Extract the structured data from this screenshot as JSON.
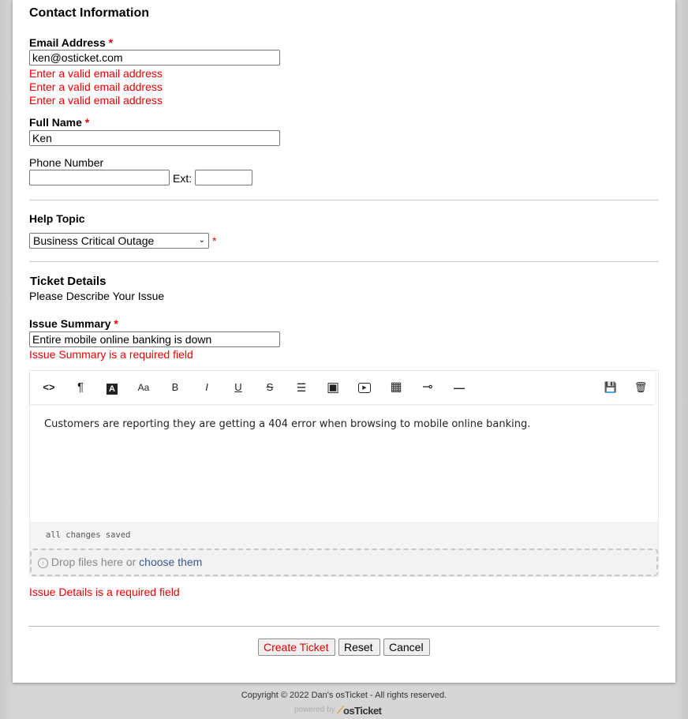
{
  "contact": {
    "heading": "Contact Information",
    "email_label": "Email Address",
    "required_mark": "*",
    "email_value": "ken@osticket.com",
    "email_errors": [
      "Enter a valid email address",
      "Enter a valid email address",
      "Enter a valid email address"
    ],
    "name_label": "Full Name",
    "name_value": "Ken",
    "phone_label": "Phone Number",
    "phone_value": "",
    "ext_label": "Ext:",
    "ext_value": ""
  },
  "help_topic": {
    "label": "Help Topic",
    "selected": "Business Critical Outage"
  },
  "ticket": {
    "heading": "Ticket Details",
    "subheading": "Please Describe Your Issue",
    "summary_label": "Issue Summary",
    "summary_value": "Entire mobile online banking is down",
    "summary_error": "Issue Summary is a required field",
    "editor_content": "Customers are reporting they are getting a 404 error when browsing to mobile online banking.",
    "saved_status": "all changes saved",
    "drop_text": "Drop files here or",
    "drop_link": "choose them",
    "details_error": "Issue Details is a required field"
  },
  "toolbar_icons": {
    "code": "<>",
    "paragraph": "¶",
    "text_color": "A",
    "font_size": "Aa",
    "bold": "B",
    "italic": "I",
    "underline": "U",
    "strike": "S",
    "list": "☰",
    "image": "▣",
    "video": "▶",
    "table": "▦",
    "link": "⊸",
    "hr": "—",
    "save": "💾",
    "delete": "🗑"
  },
  "buttons": {
    "create": "Create Ticket",
    "reset": "Reset",
    "cancel": "Cancel"
  },
  "footer": {
    "copyright": "Copyright © 2022 Dan's osTicket - All rights reserved.",
    "powered_by": "powered by",
    "brand": "osTicket"
  },
  "colors": {
    "error": "#e00000",
    "link": "#3a5a8c"
  }
}
